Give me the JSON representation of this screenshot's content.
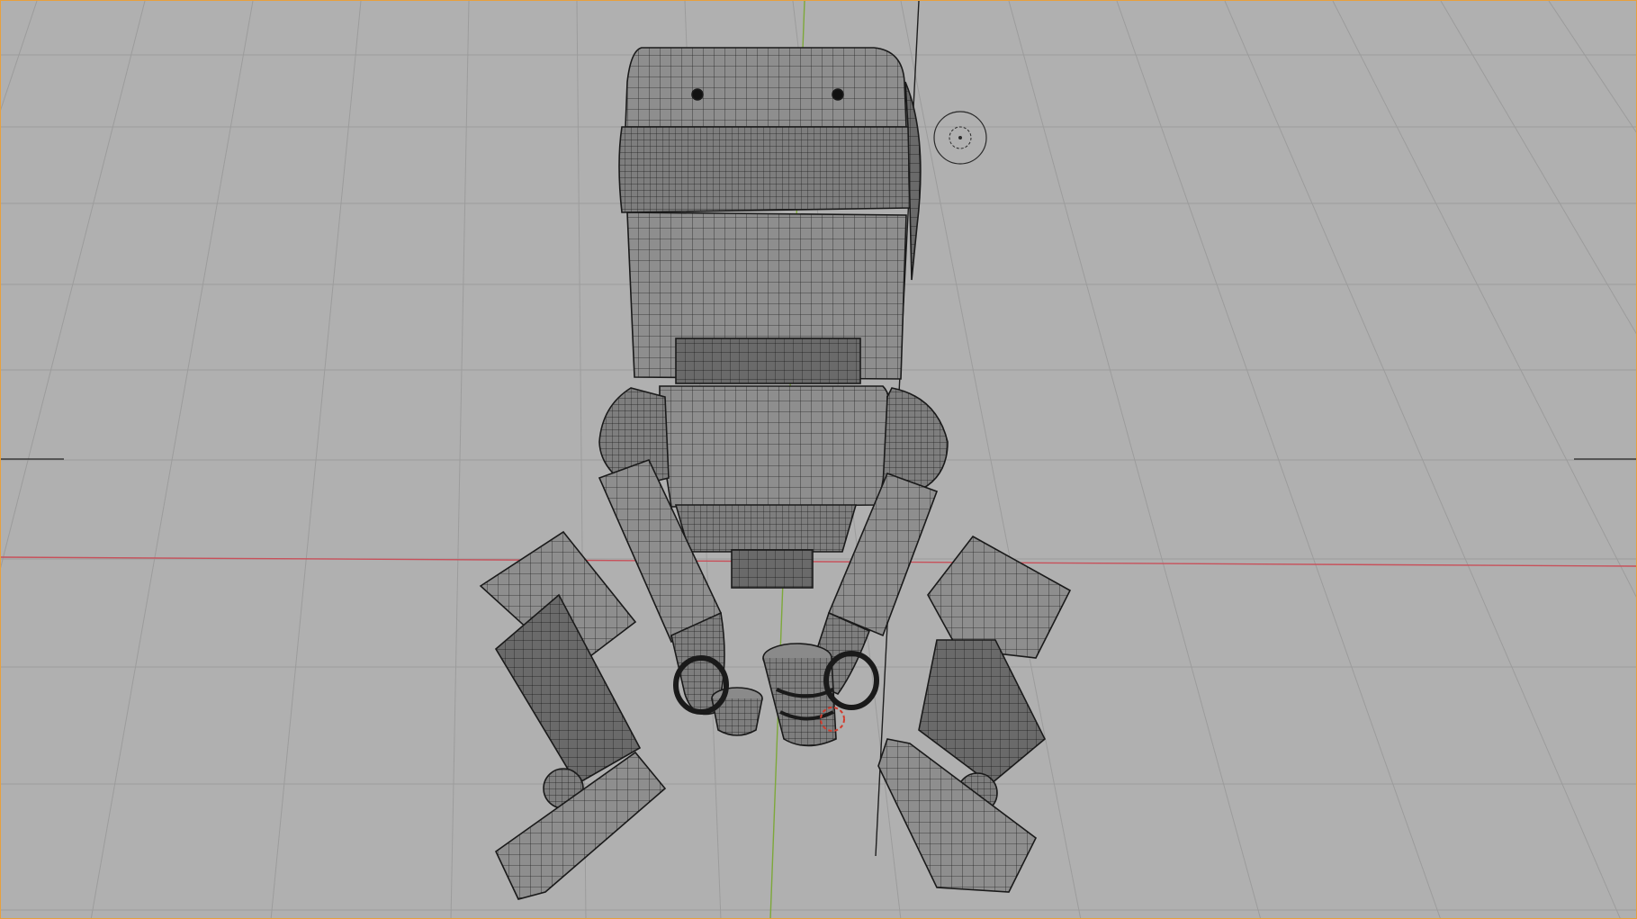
{
  "viewport": {
    "mode": "wireframe-on-solid",
    "background_color": "#b0b0b0",
    "grid_color": "#9c9c9c",
    "x_axis_color": "#c8505a",
    "y_axis_color": "#7da83a",
    "active_border_color": "#e8a03c"
  },
  "scene": {
    "object": "robot-mesh",
    "mesh_fill": "#8c8c8c",
    "mesh_wire": "#1e1e1e",
    "selected_loop_color": "#d23c2d"
  }
}
